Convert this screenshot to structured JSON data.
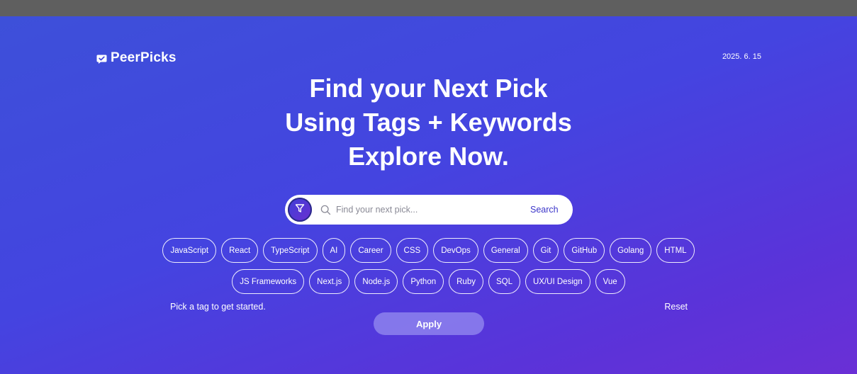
{
  "brand": {
    "name": "PeerPicks",
    "logo_icon": "chat-check-icon"
  },
  "date": "2025. 6. 15",
  "headline": {
    "line1": "Find your Next Pick",
    "line2": "Using Tags + Keywords",
    "line3": "Explore Now."
  },
  "search": {
    "filter_icon": "filter-icon",
    "search_icon": "search-icon",
    "placeholder": "Find your next pick...",
    "value": "",
    "button_label": "Search"
  },
  "tags": {
    "row1": [
      "JavaScript",
      "React",
      "TypeScript",
      "AI",
      "Career",
      "CSS",
      "DevOps",
      "General",
      "Git",
      "GitHub",
      "Golang",
      "HTML"
    ],
    "row2": [
      "JS Frameworks",
      "Next.js",
      "Node.js",
      "Python",
      "Ruby",
      "SQL",
      "UX/UI Design",
      "Vue"
    ]
  },
  "hint": "Pick a tag to get started.",
  "reset_label": "Reset",
  "apply_label": "Apply",
  "colors": {
    "accent": "#3b35c9",
    "gradient_start": "#3d50d9",
    "gradient_end": "#6a2fd6",
    "apply_bg": "#968cf0"
  }
}
